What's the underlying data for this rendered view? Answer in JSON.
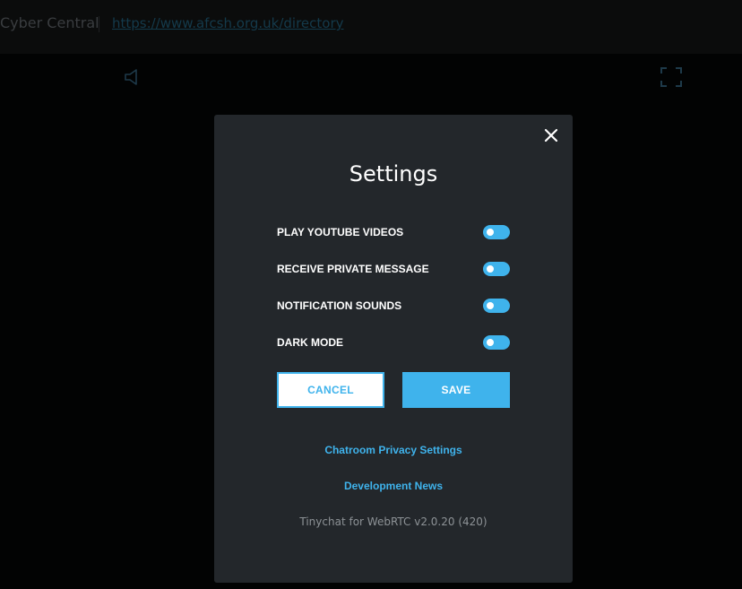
{
  "header": {
    "room_title": "Cyber Central",
    "room_url": "https://www.afcsh.org.uk/directory"
  },
  "icons": {
    "speaker": "speaker-icon",
    "fullscreen": "fullscreen-icon",
    "close": "close-icon"
  },
  "settings_modal": {
    "title": "Settings",
    "options": [
      {
        "label": "PLAY YOUTUBE VIDEOS",
        "enabled": true
      },
      {
        "label": "RECEIVE PRIVATE MESSAGE",
        "enabled": true
      },
      {
        "label": "NOTIFICATION SOUNDS",
        "enabled": true
      },
      {
        "label": "DARK MODE",
        "enabled": true
      }
    ],
    "cancel_label": "CANCEL",
    "save_label": "SAVE",
    "privacy_link": "Chatroom Privacy Settings",
    "news_link": "Development News",
    "version": "Tinychat for WebRTC v2.0.20 (420)"
  },
  "colors": {
    "accent": "#3fb3ec",
    "modal_bg": "#23272b",
    "page_bg": "#020303",
    "topbar_bg": "#0b0c0c"
  }
}
